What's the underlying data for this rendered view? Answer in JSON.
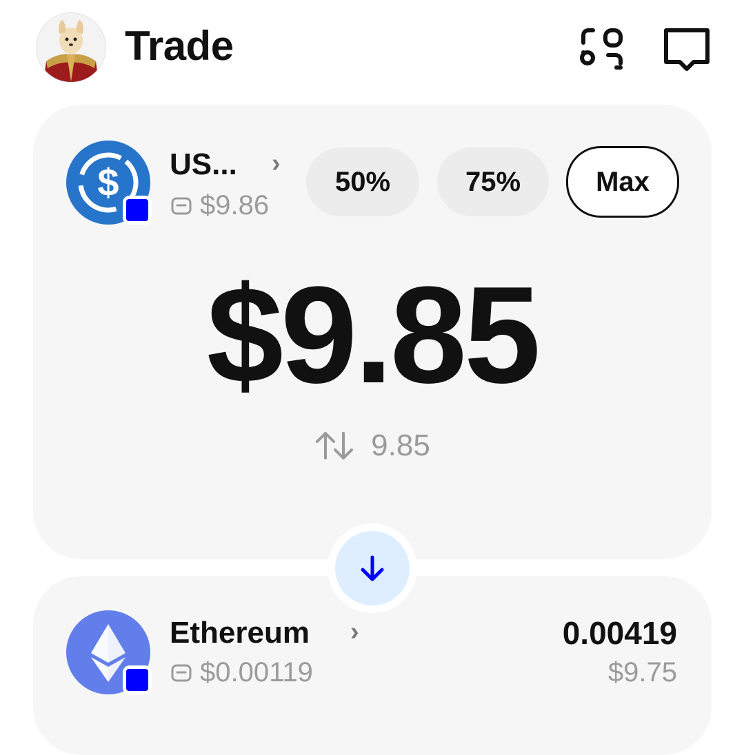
{
  "header": {
    "title": "Trade",
    "avatar": "avatar",
    "scan_icon": "scan-icon",
    "message_icon": "message-icon"
  },
  "from_token": {
    "name": "US...",
    "balance": "$9.86",
    "logo_color": "#2775CA",
    "chain_color": "#0000FF"
  },
  "percent_buttons": {
    "p50": "50%",
    "p75": "75%",
    "max": "Max"
  },
  "amount": {
    "value": "$9.85",
    "token_equiv": "9.85"
  },
  "swap": {
    "icon": "arrow-down-icon",
    "accent": "#0000FF"
  },
  "to_token": {
    "name": "Ethereum",
    "balance": "$0.00119",
    "amount": "0.00419",
    "value": "$9.75",
    "logo_color": "#627EEA"
  }
}
